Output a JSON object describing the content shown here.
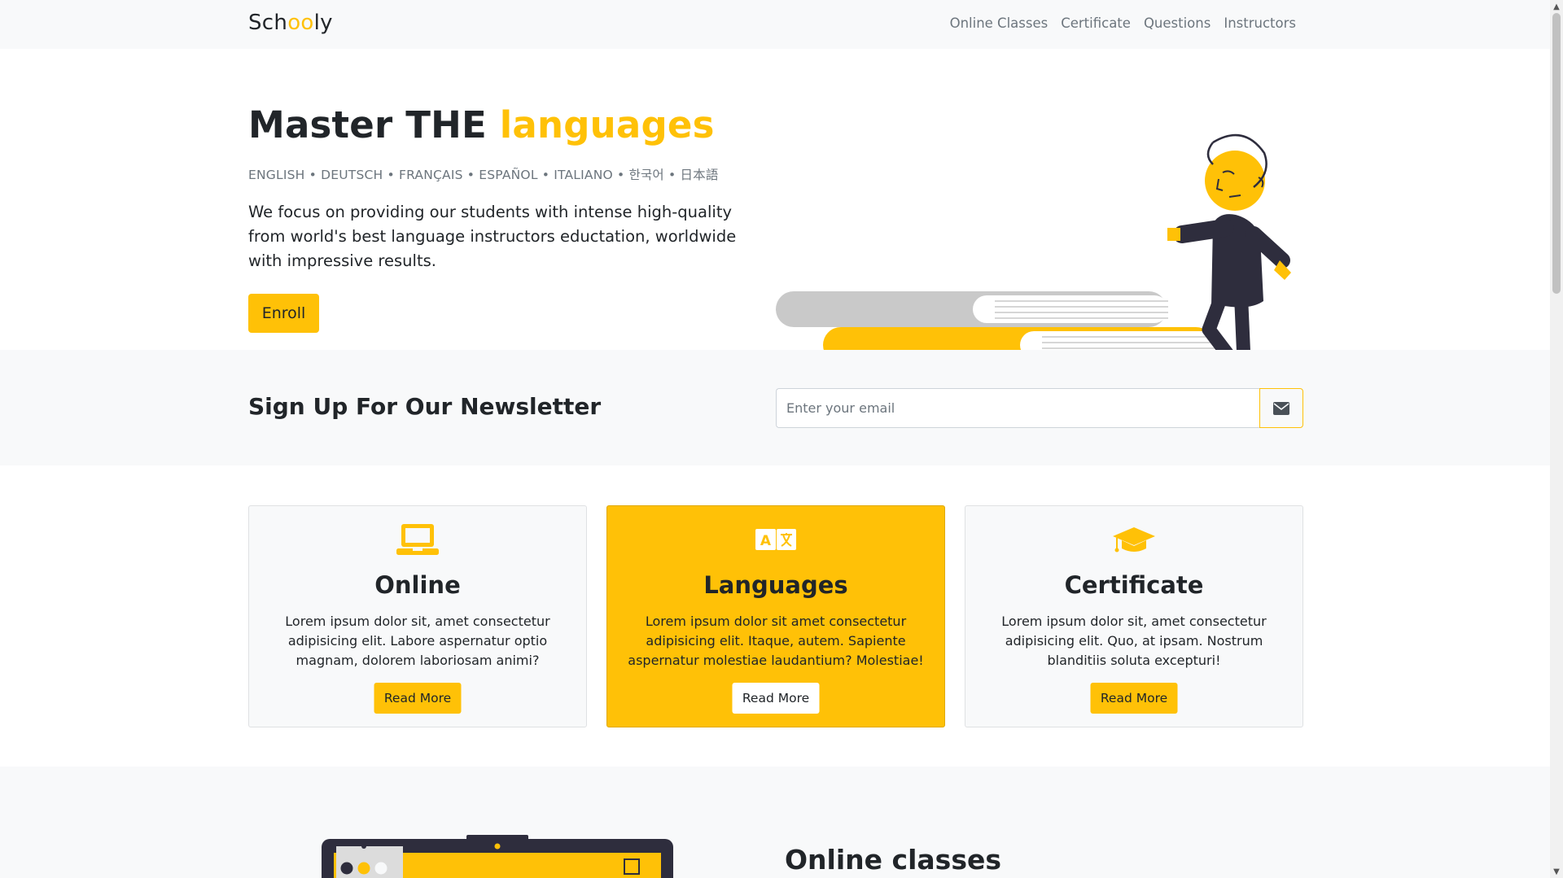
{
  "navbar": {
    "brand_prefix": "Sch",
    "brand_oo": "oo",
    "brand_suffix": "ly",
    "links": [
      "Online Classes",
      "Certificate",
      "Questions",
      "Instructors"
    ]
  },
  "hero": {
    "title_main": "Master THE",
    "title_accent": "languages",
    "languages": "ENGLISH • DEUTSCH • FRANÇAIS • ESPAÑOL • ITALIANO • 한국어 • 日本語",
    "description": "We focus on providing our students with intense high-quality from world's best language instructors eductation, worldwide with impressive results.",
    "enroll_label": "Enroll"
  },
  "newsletter": {
    "title": "Sign Up For Our Newsletter",
    "placeholder": "Enter your email",
    "button_icon": "envelope-icon"
  },
  "cards": [
    {
      "icon": "laptop-icon",
      "title": "Online",
      "text": "Lorem ipsum dolor sit, amet consectetur adipisicing elit. Labore aspernatur optio magnam, dolorem laboriosam animi?",
      "button": "Read More"
    },
    {
      "icon": "language-icon",
      "title": "Languages",
      "text": "Lorem ipsum dolor sit amet consectetur adipisicing elit. Itaque, autem. Sapiente aspernatur molestiae laudantium? Molestiae!",
      "button": "Read More"
    },
    {
      "icon": "graduation-cap-icon",
      "title": "Certificate",
      "text": "Lorem ipsum dolor sit, amet consectetur adipisicing elit. Quo, at ipsam. Nostrum blanditiis soluta excepturi!",
      "button": "Read More"
    }
  ],
  "online_classes": {
    "title": "Online classes"
  },
  "colors": {
    "accent": "#ffc107",
    "dark": "#212529",
    "muted": "#6c757d",
    "light_bg": "#f8f9fa",
    "figure_dark": "#2e2d3d",
    "book_gray": "#c9c9c9"
  }
}
